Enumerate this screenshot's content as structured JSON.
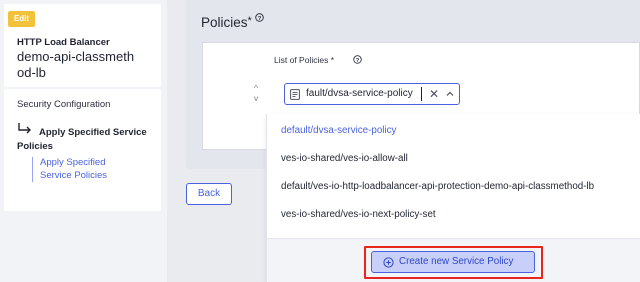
{
  "sidebar": {
    "edit_badge": "Edit",
    "lb_type": "HTTP Load Balancer",
    "lb_name": "demo-api-classmethod-lb",
    "section": "Security Configuration",
    "current_step": "Apply Specified Service Policies",
    "sub_item": "Apply Specified Service Policies"
  },
  "policies": {
    "title": "Policies",
    "required_mark": "*",
    "list_label": "List of Policies *",
    "select_value": "fault/dvsa-service-policy",
    "order_up": "^",
    "order_down": "v"
  },
  "back_label": "Back",
  "dropdown": {
    "options": [
      "default/dvsa-service-policy",
      "ves-io-shared/ves-io-allow-all",
      "default/ves-io-http-loadbalancer-api-protection-demo-api-classmethod-lb",
      "ves-io-shared/ves-io-next-policy-set"
    ],
    "selected_index": 0,
    "create_label": "Create new Service Policy"
  },
  "colors": {
    "accent": "#4a62e0",
    "edit_badge": "#f2c33a",
    "highlight": "#e8261e"
  },
  "icons": [
    "info-icon",
    "document-icon",
    "clear-icon",
    "chevron-up-icon",
    "plus-circle-icon",
    "return-arrow-icon"
  ]
}
